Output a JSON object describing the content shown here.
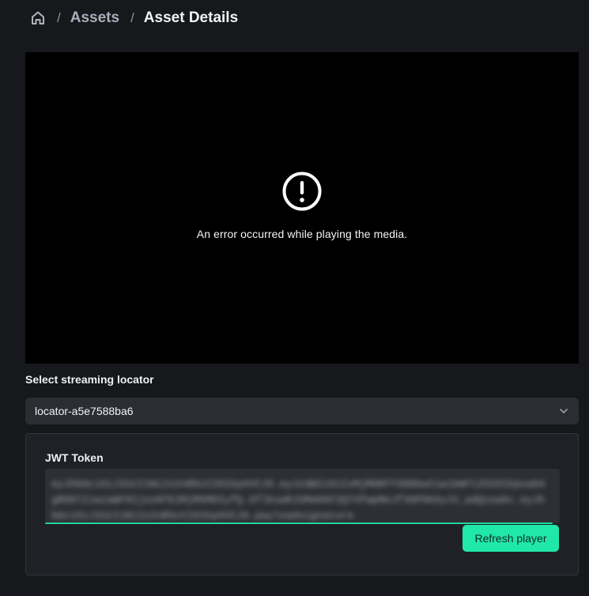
{
  "breadcrumb": {
    "home_icon": "home-icon",
    "separator": "/",
    "items": [
      {
        "label": "Assets"
      },
      {
        "label": "Asset Details"
      }
    ]
  },
  "player": {
    "error_icon": "alert-circle-icon",
    "error_message": "An error occurred while playing the media."
  },
  "locator": {
    "label": "Select streaming locator",
    "selected": "locator-a5e7588ba6",
    "dropdown_icon": "chevron-down-icon"
  },
  "jwt": {
    "label": "JWT Token",
    "token_value": "eyJhbGciOiJIUzI1NiIsInR5cCI6IkpXVCJ9.eyJzdWIiOiIxMjM0NTY3ODkwIiwibmFtZSI6IkpvaG4gRG9lIiwiaWF0IjoxNTE2MjM5MDIyfQ.SflKxwRJSMeKKF2QT4fwpMeJf36POk6yJV_adQssw5c.eyJhbGciOiJIUzI1NiIsInR5cCI6IkpXVCJ9.payloadsignature",
    "refresh_button": "Refresh player"
  },
  "colors": {
    "background": "#17181c",
    "accent": "#20e8a8",
    "player_background": "#000000"
  }
}
